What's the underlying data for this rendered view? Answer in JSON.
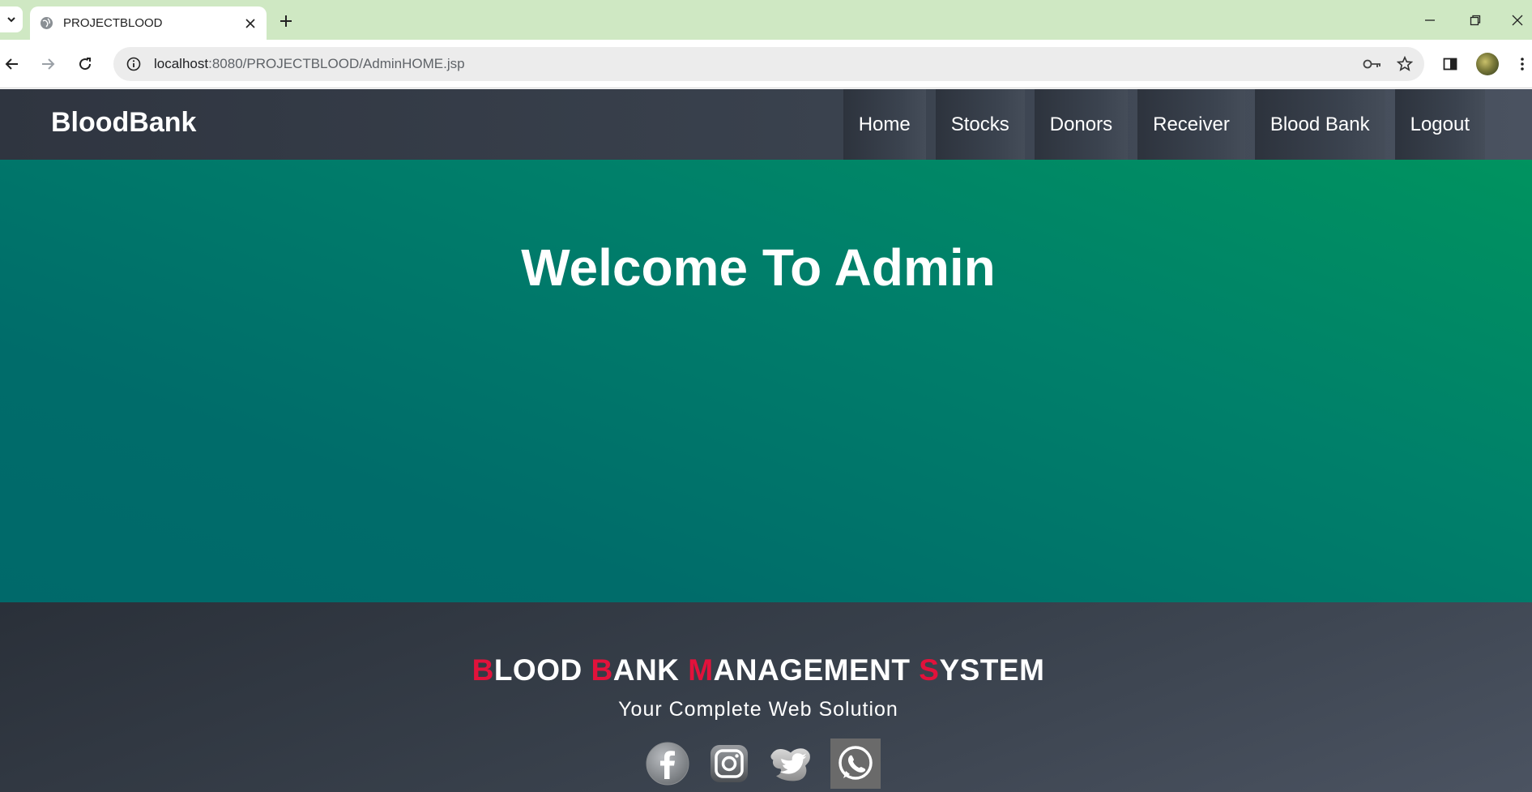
{
  "browser": {
    "tab_title": "PROJECTBLOOD",
    "url_host": "localhost",
    "url_rest": ":8080/PROJECTBLOOD/AdminHOME.jsp"
  },
  "navbar": {
    "brand": "BloodBank",
    "items": [
      {
        "label": "Home"
      },
      {
        "label": "Stocks"
      },
      {
        "label": "Donors"
      },
      {
        "label": "Receiver"
      },
      {
        "label": "Blood Bank"
      },
      {
        "label": "Logout"
      }
    ]
  },
  "hero": {
    "title": "Welcome To Admin"
  },
  "footer": {
    "title_parts": [
      {
        "initial": "B",
        "rest": "LOOD "
      },
      {
        "initial": "B",
        "rest": "ANK "
      },
      {
        "initial": "M",
        "rest": "ANAGEMENT "
      },
      {
        "initial": "S",
        "rest": "YSTEM"
      }
    ],
    "subtitle": "Your Complete Web Solution",
    "social": [
      "facebook-icon",
      "instagram-icon",
      "twitter-icon",
      "whatsapp-icon"
    ]
  },
  "colors": {
    "accent_red": "#e2123b",
    "hero_green": "#00806a",
    "navbar_dark": "#353c47"
  }
}
